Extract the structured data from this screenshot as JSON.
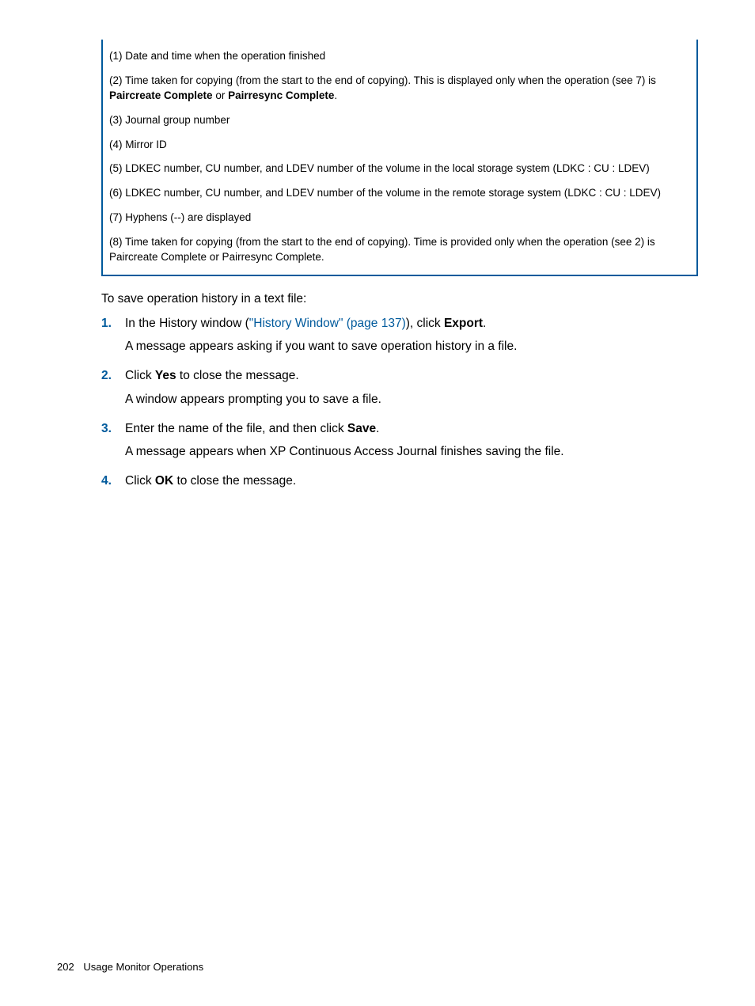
{
  "table": {
    "r1": "(1) Date and time when the operation finished",
    "r2a": "(2) Time taken for copying (from the start to the end of copying). This is displayed only when the operation (see 7) is ",
    "r2b1": "Paircreate Complete",
    "r2or": " or ",
    "r2b2": "Pairresync Complete",
    "r2end": ".",
    "r3": "(3) Journal group number",
    "r4": "(4) Mirror ID",
    "r5": "(5) LDKEC number, CU number, and LDEV number of the volume in the local storage system (LDKC : CU : LDEV)",
    "r6": "(6) LDKEC number, CU number, and LDEV number of the volume in the remote storage system (LDKC : CU : LDEV)",
    "r7": "(7) Hyphens (--) are displayed",
    "r8": "(8) Time taken for copying (from the start to the end of copying). Time is provided only when the operation (see 2) is Paircreate Complete or Pairresync Complete."
  },
  "intro": "To save operation history in a text file:",
  "steps": {
    "n1": "1.",
    "s1a": "In the History window (",
    "s1link": "\"History Window\" (page 137)",
    "s1b": "), click ",
    "s1bold": "Export",
    "s1end": ".",
    "s1p2": "A message appears asking if you want to save operation history in a file.",
    "n2": "2.",
    "s2a": "Click ",
    "s2bold": "Yes",
    "s2b": " to close the message.",
    "s2p2": "A window appears prompting you to save a file.",
    "n3": "3.",
    "s3a": "Enter the name of the file, and then click ",
    "s3bold": "Save",
    "s3end": ".",
    "s3p2": "A message appears when XP Continuous Access Journal finishes saving the file.",
    "n4": "4.",
    "s4a": "Click ",
    "s4bold": "OK",
    "s4b": " to close the message."
  },
  "footer": {
    "page": "202",
    "section": "Usage Monitor Operations"
  }
}
